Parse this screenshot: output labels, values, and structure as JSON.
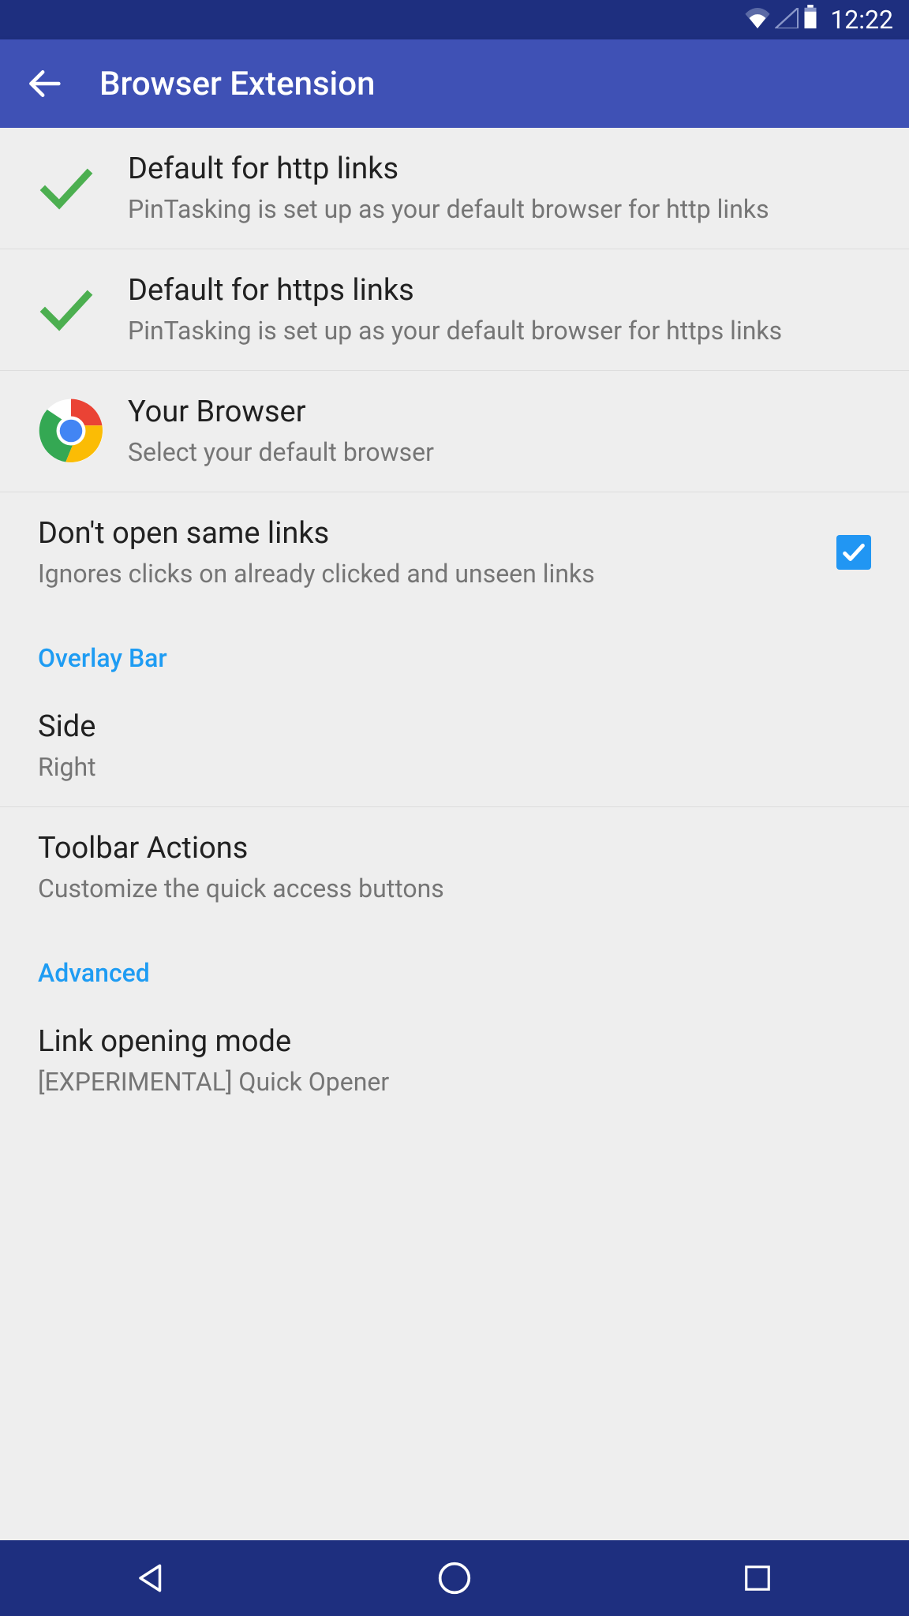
{
  "status": {
    "time": "12:22"
  },
  "appbar": {
    "title": "Browser Extension"
  },
  "rows": {
    "http": {
      "title": "Default for http links",
      "subtitle": "PinTasking is set up as your default browser for http links"
    },
    "https": {
      "title": "Default for https links",
      "subtitle": "PinTasking is set up as your default browser for https links"
    },
    "browser": {
      "title": "Your Browser",
      "subtitle": "Select your default browser"
    },
    "same_links": {
      "title": "Don't open same links",
      "subtitle": "Ignores clicks on already clicked and unseen links",
      "checked": true
    },
    "side": {
      "title": "Side",
      "subtitle": "Right"
    },
    "toolbar": {
      "title": "Toolbar Actions",
      "subtitle": "Customize the quick access buttons"
    },
    "link_mode": {
      "title": "Link opening mode",
      "subtitle": "[EXPERIMENTAL] Quick Opener"
    }
  },
  "sections": {
    "overlay": "Overlay Bar",
    "advanced": "Advanced"
  }
}
